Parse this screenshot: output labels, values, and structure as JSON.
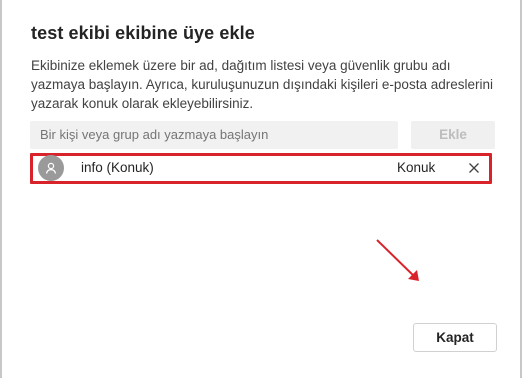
{
  "dialog": {
    "title": "test ekibi ekibine üye ekle",
    "description": "Ekibinize eklemek üzere bir ad, dağıtım listesi veya güvenlik grubu adı yazmaya başlayın. Ayrıca, kuruluşunuzun dışındaki kişileri e-posta adreslerini yazarak konuk olarak ekleyebilirsiniz.",
    "search": {
      "placeholder": "Bir kişi veya grup adı yazmaya başlayın",
      "value": ""
    },
    "add_button": "Ekle",
    "selected_member": {
      "name": "info (Konuk)",
      "role": "Konuk"
    },
    "close_button": "Kapat"
  },
  "icons": {
    "avatar": "person-icon",
    "remove": "close-icon",
    "annotation": "arrow-icon"
  },
  "colors": {
    "highlight": "#d9232a",
    "annotation_arrow": "#d9232a",
    "avatar_bg": "#9a9a9a"
  }
}
